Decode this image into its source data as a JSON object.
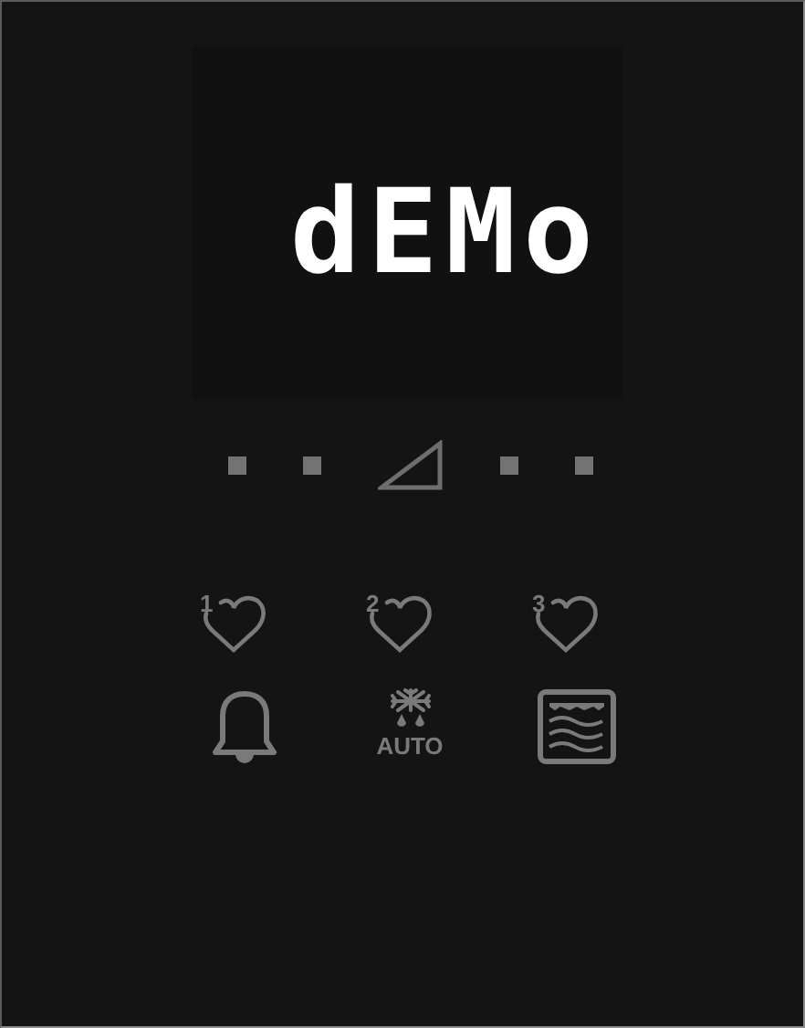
{
  "display": {
    "text": "dEMo"
  },
  "favorites": [
    {
      "number": "1"
    },
    {
      "number": "2"
    },
    {
      "number": "3"
    }
  ],
  "auto_button": {
    "label": "AUTO"
  }
}
